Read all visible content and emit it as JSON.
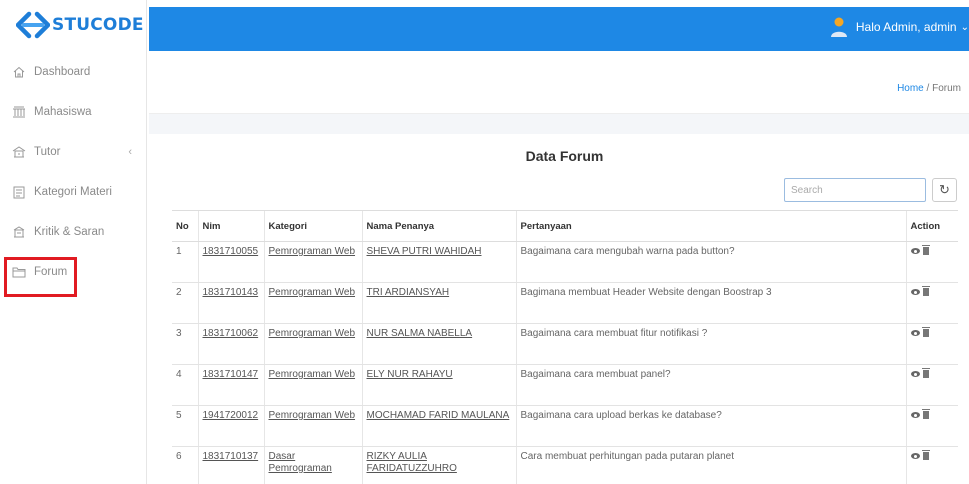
{
  "brand": {
    "name": "STUCODE",
    "color": "#1e7ed8"
  },
  "sidebar": {
    "items": [
      {
        "label": "Dashboard",
        "icon": "home-icon"
      },
      {
        "label": "Mahasiswa",
        "icon": "students-icon"
      },
      {
        "label": "Tutor",
        "icon": "tutor-icon",
        "expandable": true
      },
      {
        "label": "Kategori Materi",
        "icon": "calendar-icon"
      },
      {
        "label": "Kritik & Saran",
        "icon": "feedback-icon"
      },
      {
        "label": "Forum",
        "icon": "folder-icon",
        "highlighted": true
      }
    ]
  },
  "topbar": {
    "greeting": "Halo Admin, admin",
    "color": "#1e88e5"
  },
  "breadcrumb": {
    "home": "Home",
    "sep": " / ",
    "current": "Forum"
  },
  "main": {
    "title": "Data Forum",
    "search_placeholder": "Search",
    "table": {
      "headers": [
        "No",
        "Nim",
        "Kategori",
        "Nama Penanya",
        "Pertanyaan",
        "Action"
      ],
      "rows": [
        {
          "no": "1",
          "nim": "1831710055",
          "kategori": "Pemrograman Web",
          "nama": "SHEVA PUTRI WAHIDAH",
          "pertanyaan": "Bagaimana cara mengubah warna pada button?"
        },
        {
          "no": "2",
          "nim": "1831710143",
          "kategori": "Pemrograman Web",
          "nama": "TRI ARDIANSYAH",
          "pertanyaan": "Bagimana membuat Header Website dengan Boostrap 3"
        },
        {
          "no": "3",
          "nim": "1831710062",
          "kategori": "Pemrograman Web",
          "nama": "NUR SALMA NABELLA",
          "pertanyaan": "Bagaimana cara membuat fitur notifikasi ?"
        },
        {
          "no": "4",
          "nim": "1831710147",
          "kategori": "Pemrograman Web",
          "nama": "ELY NUR RAHAYU",
          "pertanyaan": "Bagaimana cara membuat panel?"
        },
        {
          "no": "5",
          "nim": "1941720012",
          "kategori": "Pemrograman Web",
          "nama": "MOCHAMAD FARID MAULANA",
          "pertanyaan": "Bagaimana cara upload berkas ke database?"
        },
        {
          "no": "6",
          "nim": "1831710137",
          "kategori": "Dasar Pemrograman",
          "nama": "RIZKY AULIA FARIDATUZZUHRO",
          "pertanyaan": "Cara membuat perhitungan pada putaran planet"
        }
      ]
    }
  },
  "highlight_color": "#e11b22"
}
